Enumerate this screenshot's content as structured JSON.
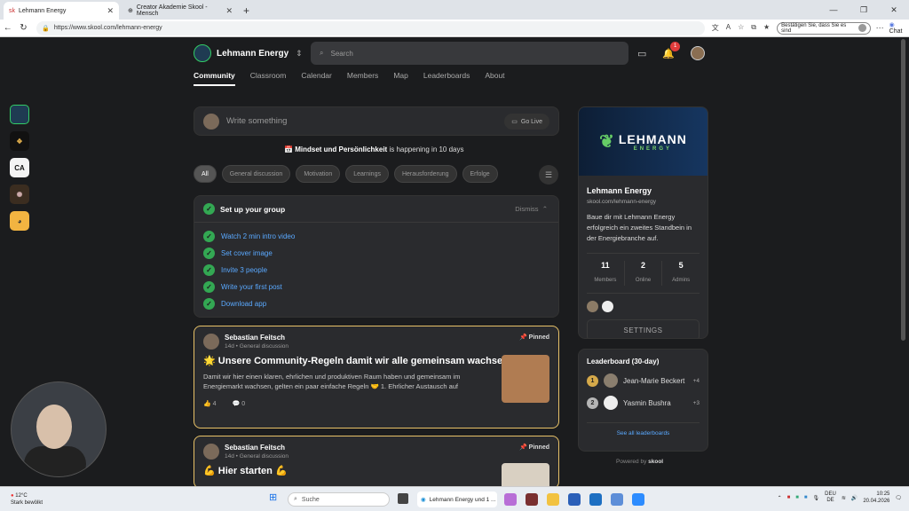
{
  "browser": {
    "tabs": [
      {
        "label": "Lehmann Energy",
        "active": true
      },
      {
        "label": "Creator Akademie Skool - Mensch",
        "active": false
      }
    ],
    "url": "https://www.skool.com/lehmann-energy",
    "confirm_label": "Bestätigen Sie, dass Sie es sind",
    "chat_label": "Chat"
  },
  "header": {
    "group_name": "Lehmann Energy",
    "search_placeholder": "Search",
    "notification_count": "1"
  },
  "nav": [
    "Community",
    "Classroom",
    "Calendar",
    "Members",
    "Map",
    "Leaderboards",
    "About"
  ],
  "composer": {
    "placeholder": "Write something",
    "go_live": "Go Live"
  },
  "event": {
    "title": "Mindset und Persönlichkeit",
    "rest": " is happening in 10 days"
  },
  "chips": [
    "All",
    "General discussion",
    "Motivation",
    "Learnings",
    "Herausforderung",
    "Erfolge"
  ],
  "setup": {
    "title": "Set up your group",
    "dismiss": "Dismiss",
    "steps": [
      "Watch 2 min intro video",
      "Set cover image",
      "Invite 3 people",
      "Write your first post",
      "Download app"
    ]
  },
  "posts": [
    {
      "author": "Sebastian Feitsch",
      "meta": "14d • General discussion",
      "pinned": "Pinned",
      "title": "🌟 Unsere Community-Regeln damit wir alle gemeinsam wachsen ...",
      "body": "Damit wir hier einen klaren, ehrlichen und produktiven Raum haben und gemeinsam im Energiemarkt wachsen, gelten ein paar einfache Regeln 🤝 1. Ehrlicher Austausch auf",
      "likes": "4",
      "comments": "0"
    },
    {
      "author": "Sebastian Feitsch",
      "meta": "14d • General discussion",
      "pinned": "Pinned",
      "title": "💪 Hier starten 💪"
    }
  ],
  "about": {
    "banner": "LEHMANN",
    "banner_sub": "ENERGY",
    "name": "Lehmann Energy",
    "url": "skool.com/lehmann-energy",
    "description": "Baue dir mit Lehmann Energy erfolgreich ein zweites Standbein in der Energiebranche auf.",
    "stats": [
      {
        "value": "11",
        "label": "Members"
      },
      {
        "value": "2",
        "label": "Online"
      },
      {
        "value": "5",
        "label": "Admins"
      }
    ],
    "settings": "SETTINGS"
  },
  "leaderboard": {
    "title": "Leaderboard (30-day)",
    "entries": [
      {
        "rank": "1",
        "name": "Jean-Marie Beckert",
        "points": "+4"
      },
      {
        "rank": "2",
        "name": "Yasmin Bushra",
        "points": "+3"
      }
    ],
    "see_all": "See all leaderboards"
  },
  "powered": {
    "prefix": "Powered by",
    "brand": "skool"
  },
  "taskbar": {
    "weather_temp": "12°C",
    "weather_text": "Stark bewölkt",
    "search": "Suche",
    "active_app": "Lehmann Energy und 1 ...",
    "lang": "DEU",
    "lang2": "DE",
    "time": "10:25",
    "date": "20.04.2026"
  }
}
